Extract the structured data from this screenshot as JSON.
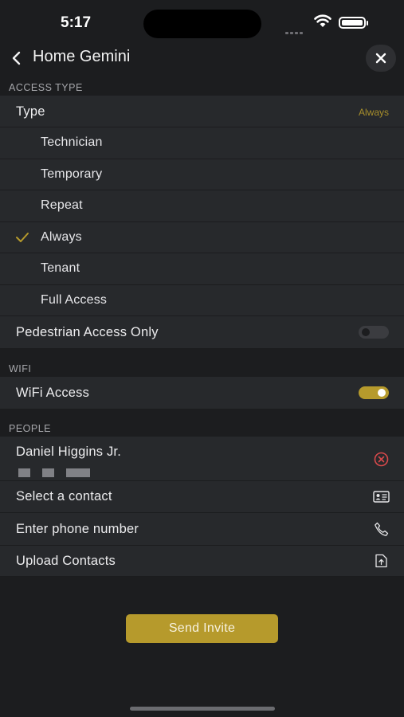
{
  "status_bar": {
    "time": "5:17"
  },
  "nav": {
    "title": "Home Gemini"
  },
  "access_type": {
    "header": "ACCESS TYPE",
    "type_label": "Type",
    "type_value": "Always",
    "options": [
      "Technician",
      "Temporary",
      "Repeat",
      "Always",
      "Tenant",
      "Full Access"
    ],
    "selected": "Always",
    "pedestrian_label": "Pedestrian Access Only",
    "pedestrian_enabled": false
  },
  "wifi": {
    "header": "WIFI",
    "access_label": "WiFi Access",
    "access_enabled": true
  },
  "people": {
    "header": "PEOPLE",
    "person_name": "Daniel Higgins Jr.",
    "select_contact": "Select a contact",
    "enter_phone": "Enter phone number",
    "upload_contacts": "Upload Contacts"
  },
  "actions": {
    "send_invite": "Send Invite"
  },
  "colors": {
    "accent": "#b69a2c",
    "background": "#1c1d1f",
    "row": "#27292c",
    "remove_red": "#d8494b"
  },
  "icons": {
    "back": "chevron-left-icon",
    "close": "close-icon",
    "check": "checkmark-icon",
    "remove": "remove-circle-icon",
    "contact_card": "contact-card-icon",
    "phone": "phone-icon",
    "upload": "upload-file-icon"
  }
}
